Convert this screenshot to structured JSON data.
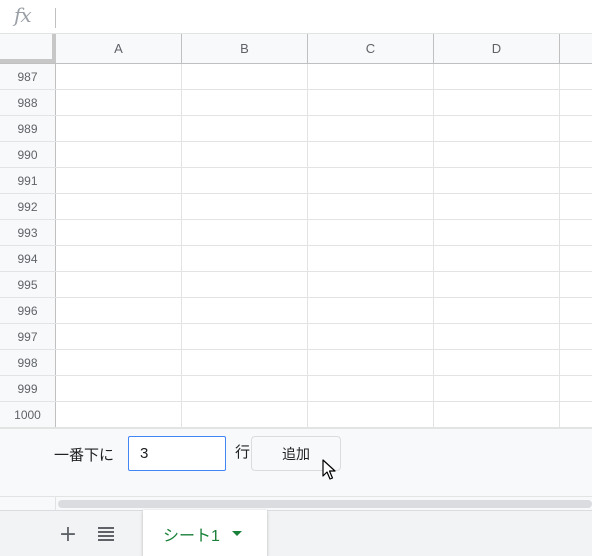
{
  "formula_bar": {
    "fx_label": "fx",
    "value": ""
  },
  "columns": [
    "A",
    "B",
    "C",
    "D"
  ],
  "rows": [
    "987",
    "988",
    "989",
    "990",
    "991",
    "992",
    "993",
    "994",
    "995",
    "996",
    "997",
    "998",
    "999",
    "1000"
  ],
  "add_rows": {
    "prefix_label": "一番下に",
    "count_value": "3",
    "suffix_label": "行",
    "button_label": "追加"
  },
  "tab_bar": {
    "add_sheet_icon": "plus-icon",
    "sheets_list_icon": "list-icon",
    "active_sheet": "シート1"
  },
  "colors": {
    "accent_green": "#188038",
    "input_focus_blue": "#4285f4",
    "header_bg": "#f8f9fa",
    "grid_line": "#e2e3e3"
  }
}
